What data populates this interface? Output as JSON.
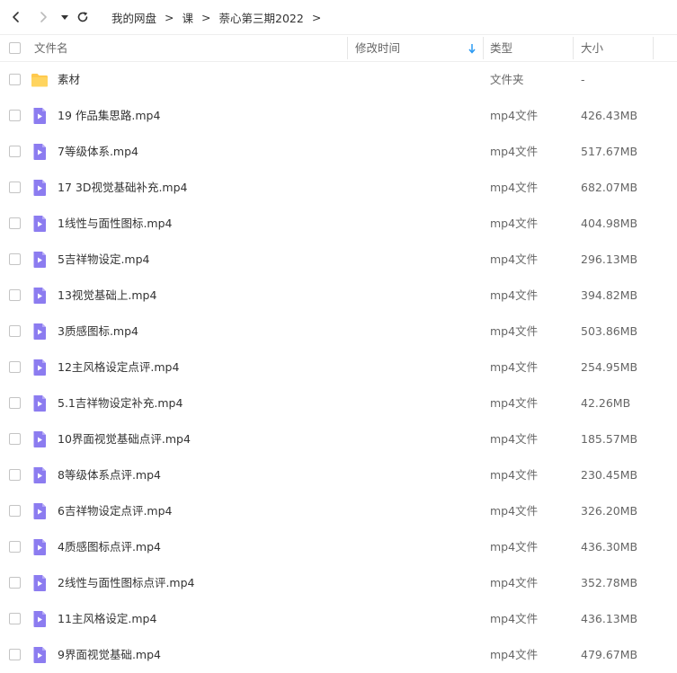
{
  "toolbar": {
    "back_icon": "chevron-left-icon",
    "forward_icon": "chevron-right-icon",
    "history_icon": "caret-down-icon",
    "refresh_icon": "refresh-icon",
    "breadcrumb": [
      "我的网盘",
      "课",
      "萘心第三期2022"
    ],
    "separator": ">"
  },
  "header": {
    "name": "文件名",
    "modified": "修改时间",
    "type": "类型",
    "size": "大小",
    "sort_icon": "arrow-down-icon",
    "sort_color": "#2b9af3"
  },
  "colors": {
    "folder": "#ffc94d",
    "video_icon": "#8c7cf0",
    "text": "#333333",
    "muted": "#666666"
  },
  "rows": [
    {
      "kind": "folder",
      "name": "素材",
      "type": "文件夹",
      "size": "-"
    },
    {
      "kind": "video",
      "name": "19 作品集思路.mp4",
      "type": "mp4文件",
      "size": "426.43MB"
    },
    {
      "kind": "video",
      "name": "7等级体系.mp4",
      "type": "mp4文件",
      "size": "517.67MB"
    },
    {
      "kind": "video",
      "name": "17 3D视觉基础补充.mp4",
      "type": "mp4文件",
      "size": "682.07MB"
    },
    {
      "kind": "video",
      "name": "1线性与面性图标.mp4",
      "type": "mp4文件",
      "size": "404.98MB"
    },
    {
      "kind": "video",
      "name": "5吉祥物设定.mp4",
      "type": "mp4文件",
      "size": "296.13MB"
    },
    {
      "kind": "video",
      "name": "13视觉基础上.mp4",
      "type": "mp4文件",
      "size": "394.82MB"
    },
    {
      "kind": "video",
      "name": "3质感图标.mp4",
      "type": "mp4文件",
      "size": "503.86MB"
    },
    {
      "kind": "video",
      "name": "12主风格设定点评.mp4",
      "type": "mp4文件",
      "size": "254.95MB"
    },
    {
      "kind": "video",
      "name": "5.1吉祥物设定补充.mp4",
      "type": "mp4文件",
      "size": "42.26MB"
    },
    {
      "kind": "video",
      "name": "10界面视觉基础点评.mp4",
      "type": "mp4文件",
      "size": "185.57MB"
    },
    {
      "kind": "video",
      "name": "8等级体系点评.mp4",
      "type": "mp4文件",
      "size": "230.45MB"
    },
    {
      "kind": "video",
      "name": "6吉祥物设定点评.mp4",
      "type": "mp4文件",
      "size": "326.20MB"
    },
    {
      "kind": "video",
      "name": "4质感图标点评.mp4",
      "type": "mp4文件",
      "size": "436.30MB"
    },
    {
      "kind": "video",
      "name": "2线性与面性图标点评.mp4",
      "type": "mp4文件",
      "size": "352.78MB"
    },
    {
      "kind": "video",
      "name": "11主风格设定.mp4",
      "type": "mp4文件",
      "size": "436.13MB"
    },
    {
      "kind": "video",
      "name": "9界面视觉基础.mp4",
      "type": "mp4文件",
      "size": "479.67MB"
    }
  ]
}
